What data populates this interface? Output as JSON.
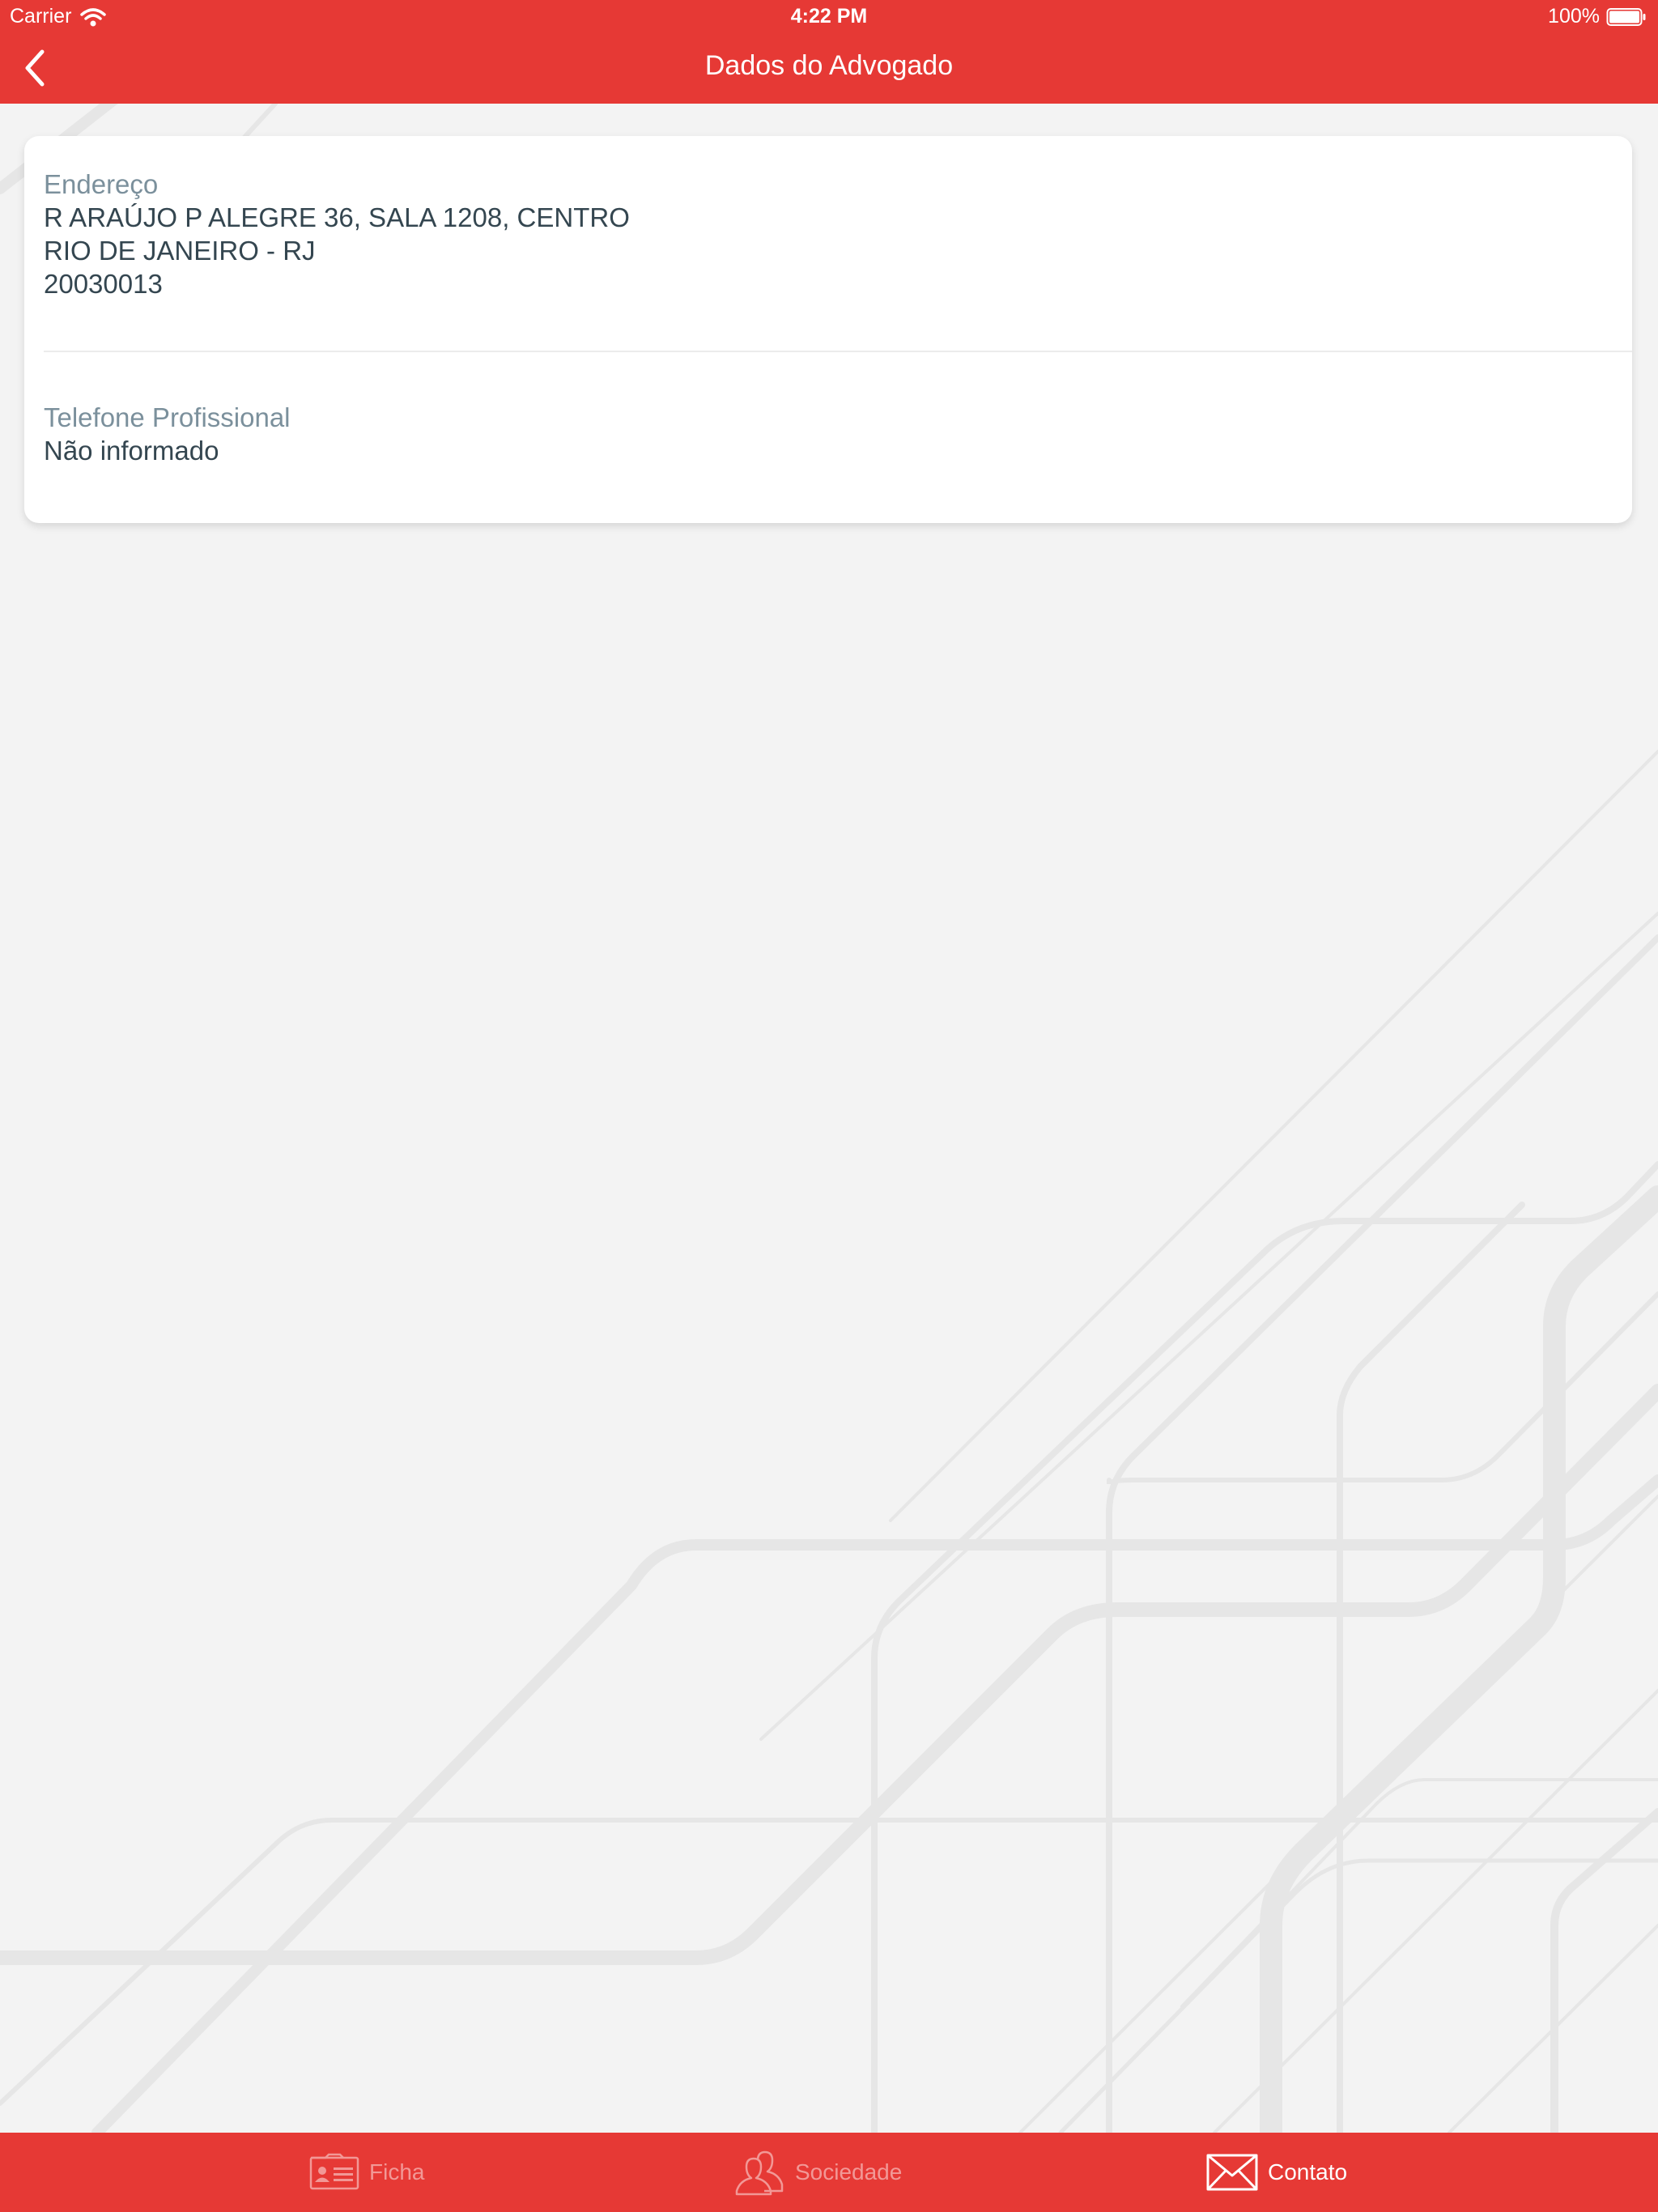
{
  "status_bar": {
    "carrier": "Carrier",
    "time": "4:22 PM",
    "battery": "100%"
  },
  "nav": {
    "back_icon": "chevron-left-icon",
    "title": "Dados do Advogado"
  },
  "card": {
    "address": {
      "label": "Endereço",
      "lines": [
        "R ARAÚJO P ALEGRE 36, SALA 1208, CENTRO",
        "RIO DE JANEIRO - RJ",
        "20030013"
      ]
    },
    "phone": {
      "label": "Telefone Profissional",
      "value": "Não informado"
    }
  },
  "tabbar": {
    "tabs": [
      {
        "label": "Ficha",
        "icon": "id-card-icon",
        "active": false
      },
      {
        "label": "Sociedade",
        "icon": "people-icon",
        "active": false
      },
      {
        "label": "Contato",
        "icon": "envelope-icon",
        "active": true
      }
    ]
  },
  "colors": {
    "brand_red": "#e63935",
    "background": "#f3f3f3",
    "label_gray": "#7b909c",
    "value_dark": "#344650",
    "inactive_tab": "#f29896"
  }
}
